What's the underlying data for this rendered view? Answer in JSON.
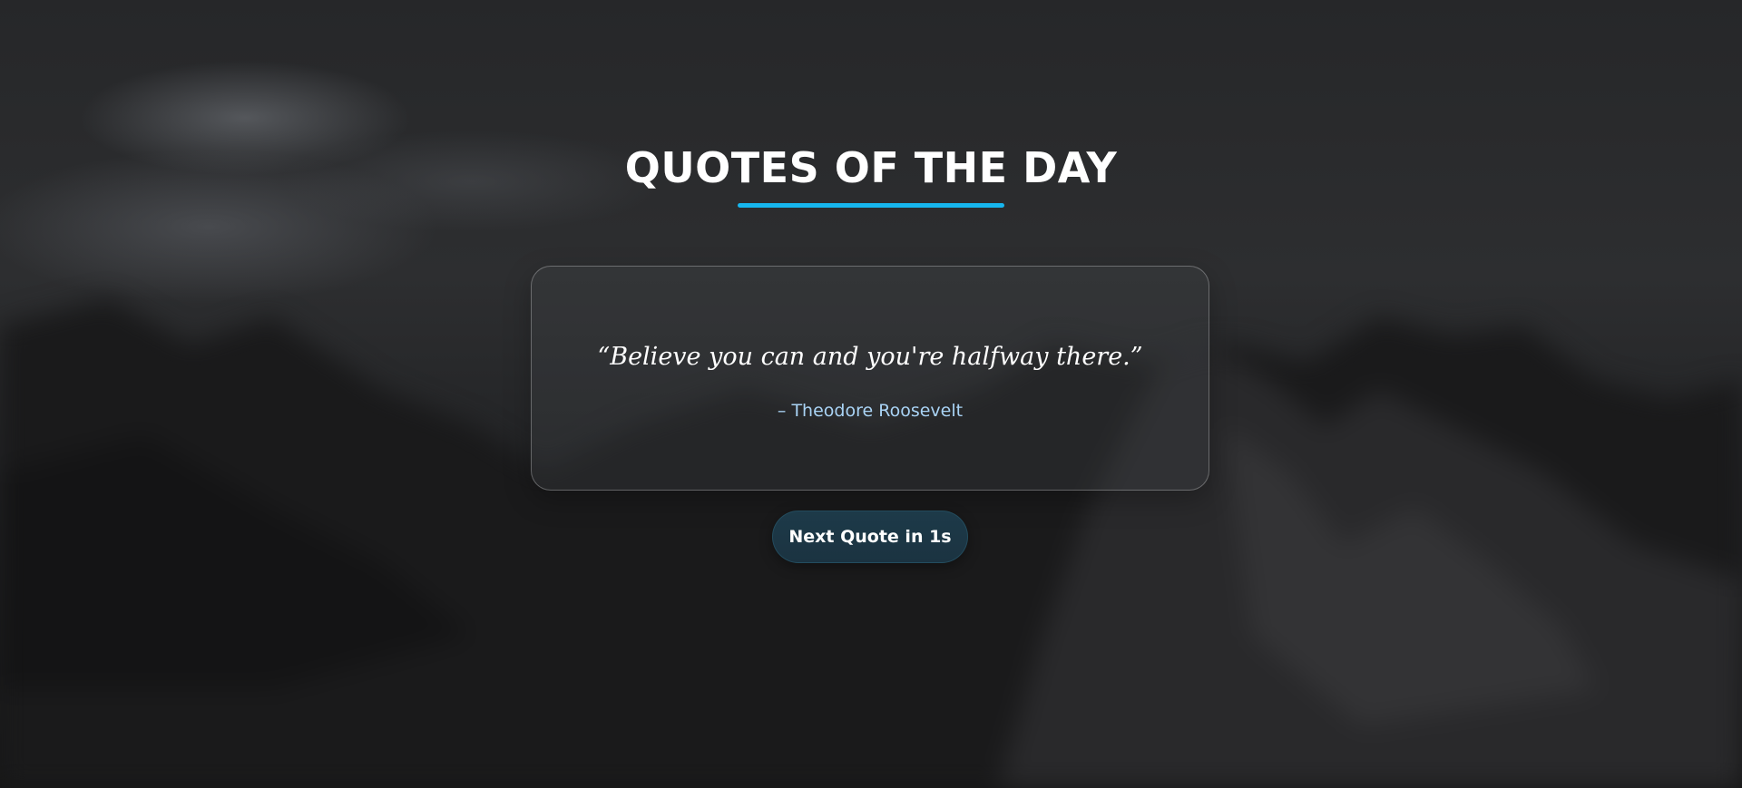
{
  "header": {
    "title": "QUOTES OF THE DAY",
    "accent_color": "#16b6ee"
  },
  "quote": {
    "text": "“Believe you can and you're halfway there.”",
    "author": "– Theodore Roosevelt",
    "author_color": "#a9d3f5"
  },
  "controls": {
    "next_button_label": "Next Quote in 1s"
  }
}
